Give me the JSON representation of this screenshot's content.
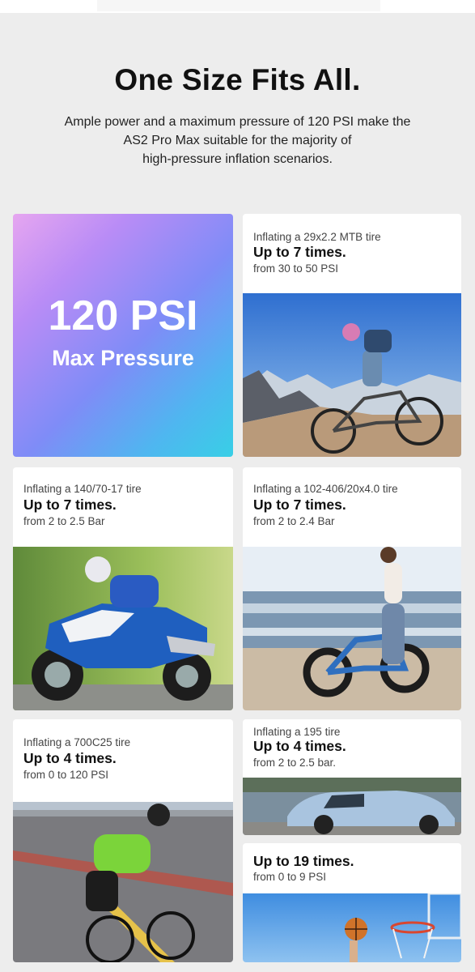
{
  "header": {
    "title": "One Size Fits All.",
    "subtitle_lines": [
      "Ample power and a maximum pressure of 120 PSI make the",
      "AS2 Pro Max suitable for the majority of",
      "high-pressure inflation scenarios."
    ]
  },
  "feature": {
    "value": "120 PSI",
    "label": "Max Pressure"
  },
  "cards": [
    {
      "caption": "Inflating a 29x2.2 MTB tire",
      "headline": "Up to 7 times.",
      "range": "from 30 to 50 PSI",
      "image": "mountain-bike-photo"
    },
    {
      "caption": "Inflating a 140/70-17 tire",
      "headline": "Up to 7 times.",
      "range": "from 2 to 2.5 Bar",
      "image": "motorcycle-photo"
    },
    {
      "caption": "Inflating a 102-406/20x4.0 tire",
      "headline": "Up to 7 times.",
      "range": "from 2 to 2.4 Bar",
      "image": "fat-tire-ebike-photo"
    },
    {
      "caption": "Inflating a 700C25 tire",
      "headline": "Up to 4 times.",
      "range": "from 0 to 120 PSI",
      "image": "road-bike-photo"
    },
    {
      "caption": "Inflating a 195 tire",
      "headline": "Up to 4 times.",
      "range": "from 2 to 2.5 bar.",
      "image": "car-photo"
    },
    {
      "caption": "",
      "headline": "Up to 19 times.",
      "range": "from 0 to 9 PSI",
      "image": "basketball-photo"
    }
  ]
}
